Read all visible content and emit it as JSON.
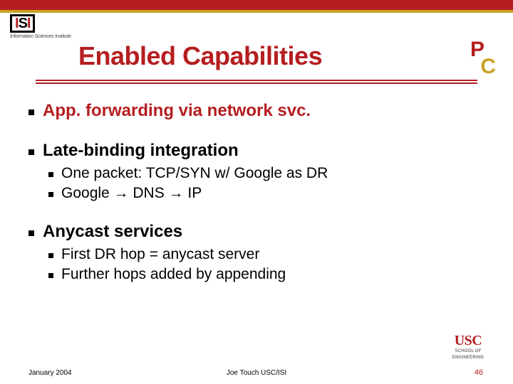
{
  "header": {
    "isi_mark_left": "I",
    "isi_mark_mid": "S",
    "isi_mark_right": "I",
    "isi_subtext": "Information Sciences Institute",
    "pc_p": "P",
    "pc_c": "C"
  },
  "title": "Enabled Capabilities",
  "bullets": [
    {
      "text": "App. forwarding via network svc.",
      "red": true,
      "sub": []
    },
    {
      "text": "Late-binding integration",
      "red": false,
      "sub": [
        "One packet: TCP/SYN w/ Google as DR",
        "Google → DNS → IP"
      ]
    },
    {
      "text": "Anycast services",
      "red": false,
      "sub": [
        "First DR hop = anycast server",
        "Further hops added by appending"
      ]
    }
  ],
  "footer": {
    "date": "January 2004",
    "center": "Joe Touch USC/ISI",
    "page": "46"
  },
  "usc": {
    "mark": "USC",
    "sub1": "SCHOOL OF",
    "sub2": "ENGINEERING"
  }
}
